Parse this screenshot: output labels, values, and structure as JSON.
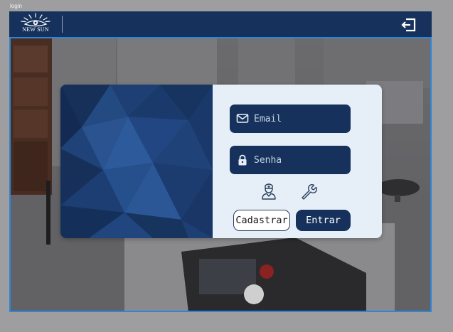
{
  "window": {
    "title": "login"
  },
  "header": {
    "logo_text": "NEW SUN",
    "logo_icon": "sun-eye-logo-icon",
    "exit_icon": "logout-icon"
  },
  "login": {
    "email": {
      "value": "",
      "placeholder": "Email",
      "icon": "mail-icon"
    },
    "password": {
      "value": "",
      "placeholder": "Senha",
      "icon": "lock-icon"
    },
    "doctor_icon": "doctor-icon",
    "settings_icon": "wrench-icon",
    "register_label": "Cadastrar",
    "submit_label": "Entrar"
  },
  "colors": {
    "navy": "#16325c",
    "accent_border": "#2f86d6",
    "card_bg": "#e6eff7",
    "frame_bg": "#9e9ea0"
  }
}
